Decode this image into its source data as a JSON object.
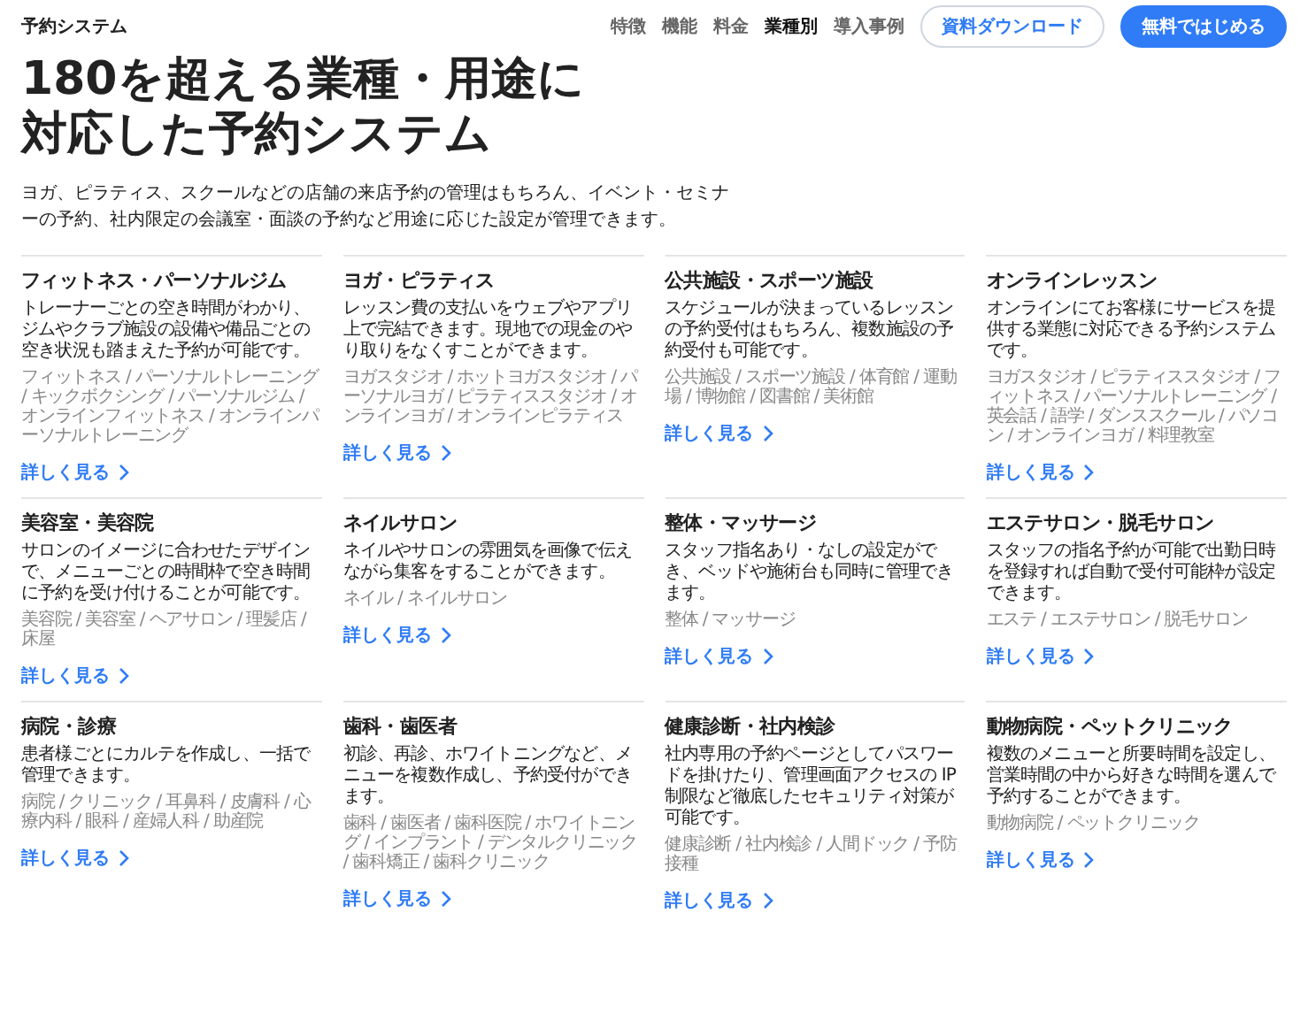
{
  "header": {
    "logo": "予約システム",
    "nav": [
      {
        "label": "特徴",
        "selected": false
      },
      {
        "label": "機能",
        "selected": false
      },
      {
        "label": "料金",
        "selected": false
      },
      {
        "label": "業種別",
        "selected": true
      },
      {
        "label": "導入事例",
        "selected": false
      }
    ],
    "buttons": [
      {
        "label": "資料ダウンロード",
        "kind": "outline"
      },
      {
        "label": "無料ではじめる",
        "kind": "primary"
      }
    ]
  },
  "hero": {
    "title_lines": [
      "180を超える業種・用途に",
      "対応した予約システム"
    ],
    "intro": "ヨガ、ピラティス、スクールなどの店舗の来店予約の管理はもちろん、イベント・セミナーの予約、社内限定の会議室・面談の予約など用途に応じた設定が管理できます。"
  },
  "industries": [
    {
      "title": "フィットネス・パーソナルジム",
      "description": "トレーナーごとの空き時間がわかり、ジムやクラブ施設の設備や備品ごとの空き状況も踏まえた予約が可能です。",
      "tags": "フィットネス / パーソナルトレーニング / キックボクシング / パーソナルジム / オンラインフィットネス / オンラインパーソナルトレーニング",
      "link": "詳しく見る"
    },
    {
      "title": "ヨガ・ピラティス",
      "description": "レッスン費の支払いをウェブやアプリ上で完結できます。現地での現金のやり取りをなくすことができます。",
      "tags": "ヨガスタジオ / ホットヨガスタジオ / パーソナルヨガ / ピラティススタジオ / オンラインヨガ / オンラインピラティス",
      "link": "詳しく見る"
    },
    {
      "title": "公共施設・スポーツ施設",
      "description": "スケジュールが決まっているレッスンの予約受付はもちろん、複数施設の予約受付も可能です。",
      "tags": "公共施設 / スポーツ施設 / 体育館 / 運動場 / 博物館 / 図書館 / 美術館",
      "link": "詳しく見る"
    },
    {
      "title": "オンラインレッスン",
      "description": "オンラインにてお客様にサービスを提供する業態に対応できる予約システムです。",
      "tags": "ヨガスタジオ / ピラティススタジオ / フィットネス / パーソナルトレーニング / 英会話 / 語学 / ダンススクール / パソコン / オンラインヨガ / 料理教室",
      "link": "詳しく見る"
    },
    {
      "title": "美容室・美容院",
      "description": "サロンのイメージに合わせたデザインで、メニューごとの時間枠で空き時間に予約を受け付けることが可能です。",
      "tags": "美容院 / 美容室 / ヘアサロン / 理髪店 / 床屋",
      "link": "詳しく見る"
    },
    {
      "title": "ネイルサロン",
      "description": "ネイルやサロンの雰囲気を画像で伝えながら集客をすることができます。",
      "tags": "ネイル / ネイルサロン",
      "link": "詳しく見る"
    },
    {
      "title": "整体・マッサージ",
      "description": "スタッフ指名あり・なしの設定ができ、ベッドや施術台も同時に管理できます。",
      "tags": "整体 / マッサージ",
      "link": "詳しく見る"
    },
    {
      "title": "エステサロン・脱毛サロン",
      "description": "スタッフの指名予約が可能で出勤日時を登録すれば自動で受付可能枠が設定できます。",
      "tags": "エステ / エステサロン / 脱毛サロン",
      "link": "詳しく見る"
    },
    {
      "title": "病院・診療",
      "description": "患者様ごとにカルテを作成し、一括で管理できます。",
      "tags": "病院 / クリニック / 耳鼻科 / 皮膚科 / 心療内科 / 眼科 / 産婦人科 / 助産院",
      "link": "詳しく見る"
    },
    {
      "title": "歯科・歯医者",
      "description": "初診、再診、ホワイトニングなど、メニューを複数作成し、予約受付ができます。",
      "tags": "歯科 / 歯医者 / 歯科医院 / ホワイトニング / インプラント / デンタルクリニック / 歯科矯正 / 歯科クリニック",
      "link": "詳しく見る"
    },
    {
      "title": "健康診断・社内検診",
      "description": "社内専用の予約ページとしてパスワードを掛けたり、管理画面アクセスの IP 制限など徹底したセキュリティ対策が可能です。",
      "tags": "健康診断 / 社内検診 / 人間ドック / 予防接種",
      "link": "詳しく見る"
    },
    {
      "title": "動物病院・ペットクリニック",
      "description": "複数のメニューと所要時間を設定し、営業時間の中から好きな時間を選んで予約することができます。",
      "tags": "動物病院 / ペットクリニック",
      "link": "詳しく見る"
    }
  ]
}
